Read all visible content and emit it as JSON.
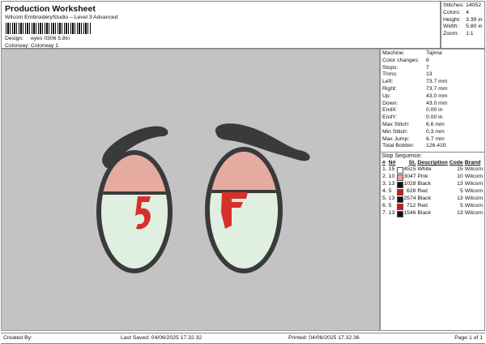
{
  "header": {
    "title": "Production Worksheet",
    "subtitle": "Wilcom EmbroideryStudio – Level 3 Advanced",
    "design_label": "Design:",
    "design": "eyes 0306 5.8in",
    "colorway_label": "Colorway:",
    "colorway": "Colorway 1"
  },
  "stats": [
    {
      "k": "Stitches:",
      "v": "14052"
    },
    {
      "k": "Colors:",
      "v": "4"
    },
    {
      "k": "Height:",
      "v": "3.39 in"
    },
    {
      "k": "Width:",
      "v": "5.80 in"
    },
    {
      "k": "Zoom:",
      "v": "1:1"
    }
  ],
  "machine": [
    {
      "k": "Machine:",
      "v": "Tajima"
    },
    {
      "k": "Color changes:",
      "v": "6"
    },
    {
      "k": "Stops:",
      "v": "7"
    },
    {
      "k": "Trims:",
      "v": "13"
    },
    {
      "k": "Left:",
      "v": "73.7 mm"
    },
    {
      "k": "Right:",
      "v": "73.7 mm"
    },
    {
      "k": "Up:",
      "v": "43.0 mm"
    },
    {
      "k": "Down:",
      "v": "43.0 mm"
    },
    {
      "k": "EndX:",
      "v": "0.00 in"
    },
    {
      "k": "EndY:",
      "v": "0.00 in"
    },
    {
      "k": "Max Stitch:",
      "v": "6.6 mm"
    },
    {
      "k": "Min Stitch:",
      "v": "0.3 mm"
    },
    {
      "k": "Max Jump:",
      "v": "6.7 mm"
    },
    {
      "k": "Total Bobbin:",
      "v": "126.41ft"
    }
  ],
  "stop_sequence": {
    "title": "Stop Sequence:",
    "headers": [
      "#",
      "N#",
      "St.",
      "Description",
      "Code",
      "Brand"
    ],
    "rows": [
      {
        "n": "1.",
        "nn": "15",
        "color": "#ffffff",
        "st": "4515",
        "desc": "White",
        "code": "15",
        "brand": "Wilcom"
      },
      {
        "n": "2.",
        "nn": "10",
        "color": "#e8a0a0",
        "st": "3047",
        "desc": "Pink",
        "code": "10",
        "brand": "Wilcom"
      },
      {
        "n": "3.",
        "nn": "13",
        "color": "#111111",
        "st": "1028",
        "desc": "Black",
        "code": "13",
        "brand": "Wilcom"
      },
      {
        "n": "4.",
        "nn": "5",
        "color": "#dd1111",
        "st": "628",
        "desc": "Red",
        "code": "5",
        "brand": "Wilcom"
      },
      {
        "n": "5.",
        "nn": "13",
        "color": "#111111",
        "st": "2574",
        "desc": "Black",
        "code": "13",
        "brand": "Wilcom"
      },
      {
        "n": "6.",
        "nn": "5",
        "color": "#dd1111",
        "st": "712",
        "desc": "Red",
        "code": "5",
        "brand": "Wilcom"
      },
      {
        "n": "7.",
        "nn": "13",
        "color": "#111111",
        "st": "1546",
        "desc": "Black",
        "code": "13",
        "brand": "Wilcom"
      }
    ]
  },
  "footer": {
    "created": "Created By:",
    "saved": "Last Saved: 04/06/2025 17.32.32",
    "printed": "Printed: 04/06/2025 17.32.36",
    "page": "Page 1 of 1"
  }
}
